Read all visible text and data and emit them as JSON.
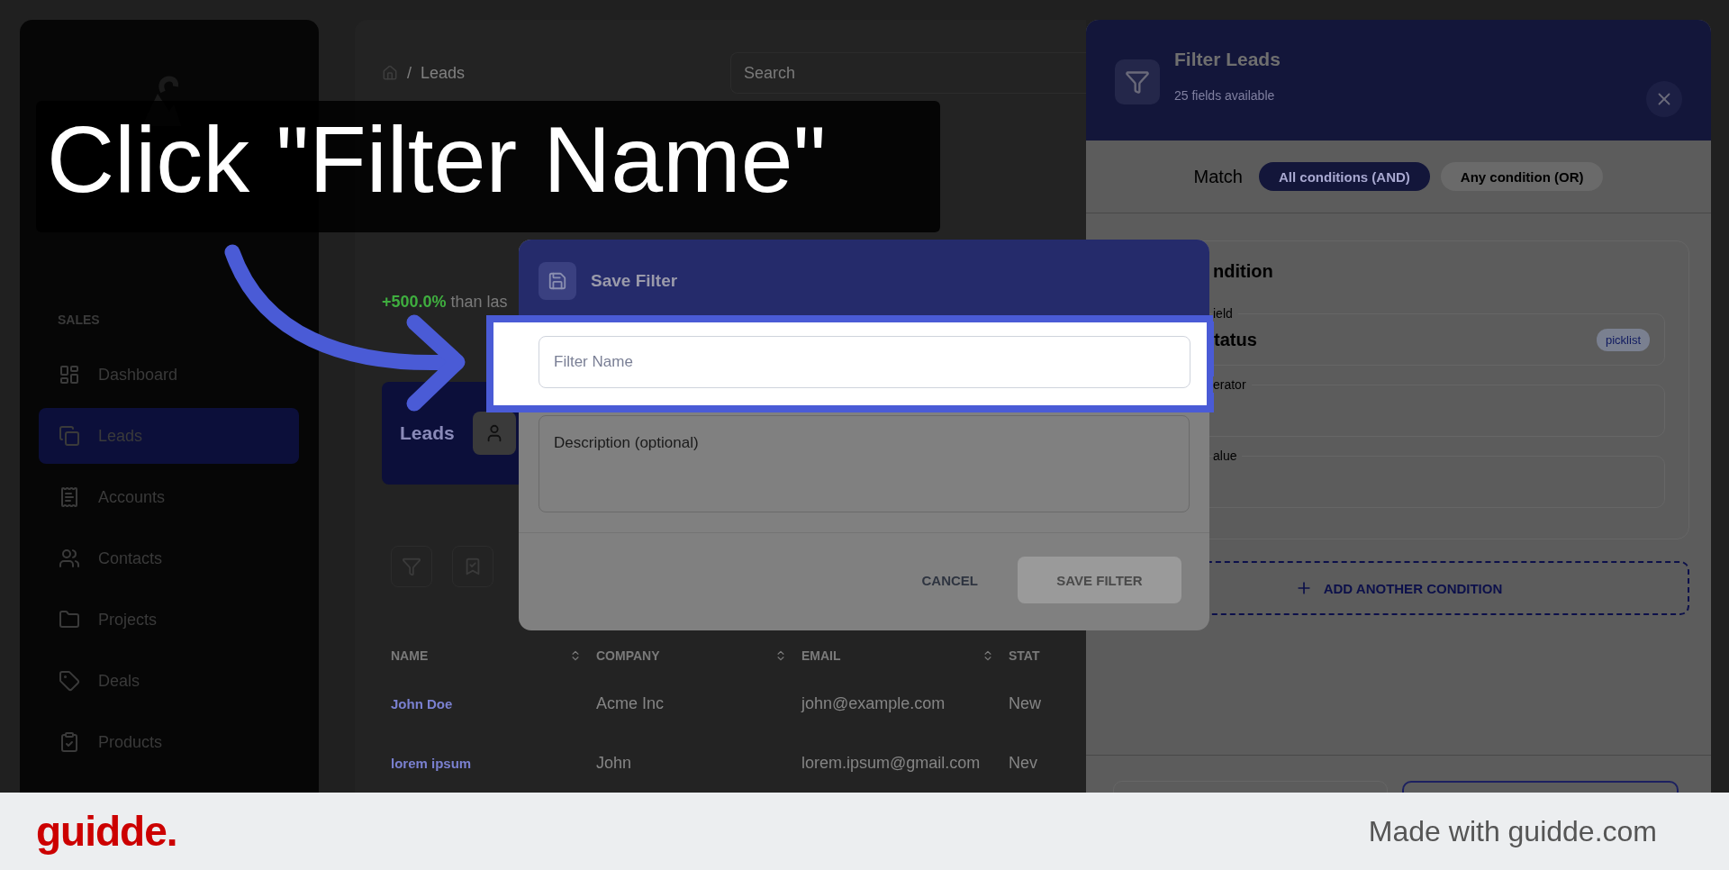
{
  "sidebar": {
    "section": "SALES",
    "items": [
      {
        "label": "Dashboard",
        "selected": false
      },
      {
        "label": "Leads",
        "selected": true
      },
      {
        "label": "Accounts",
        "selected": false
      },
      {
        "label": "Contacts",
        "selected": false
      },
      {
        "label": "Projects",
        "selected": false
      },
      {
        "label": "Deals",
        "selected": false
      },
      {
        "label": "Products",
        "selected": false
      }
    ]
  },
  "breadcrumb": {
    "separator": "/",
    "current": "Leads"
  },
  "search": {
    "placeholder": "Search"
  },
  "stat": {
    "change": "+500.0%",
    "text": "than las"
  },
  "leads_card": {
    "label": "Leads"
  },
  "table": {
    "columns": [
      "NAME",
      "COMPANY",
      "EMAIL",
      "STAT"
    ],
    "rows": [
      [
        "John Doe",
        "Acme Inc",
        "john@example.com",
        "New"
      ],
      [
        "lorem ipsum",
        "John",
        "lorem.ipsum@gmail.com",
        "Nev"
      ]
    ]
  },
  "filter_panel": {
    "title": "Filter Leads",
    "subtitle": "25 fields available",
    "match_label": "Match",
    "match_options": [
      {
        "label": "All conditions (AND)",
        "selected": true
      },
      {
        "label": "Any condition (OR)",
        "selected": false
      }
    ],
    "condition": {
      "title": "ndition",
      "fields": [
        {
          "label": "ield",
          "value": "tatus",
          "badge": "picklist"
        },
        {
          "label": "erator"
        },
        {
          "label": "alue"
        }
      ]
    },
    "add_button": "ADD ANOTHER CONDITION"
  },
  "dialog": {
    "title": "Save Filter",
    "name_placeholder": "Filter Name",
    "description_placeholder": "Description (optional)",
    "cancel": "CANCEL",
    "save": {
      "label": "SAVE FILTER",
      "disabled": true
    }
  },
  "caption": "Click \"Filter Name\"",
  "footer": {
    "logo": "guidde.",
    "credit": "Made with guidde.com"
  }
}
